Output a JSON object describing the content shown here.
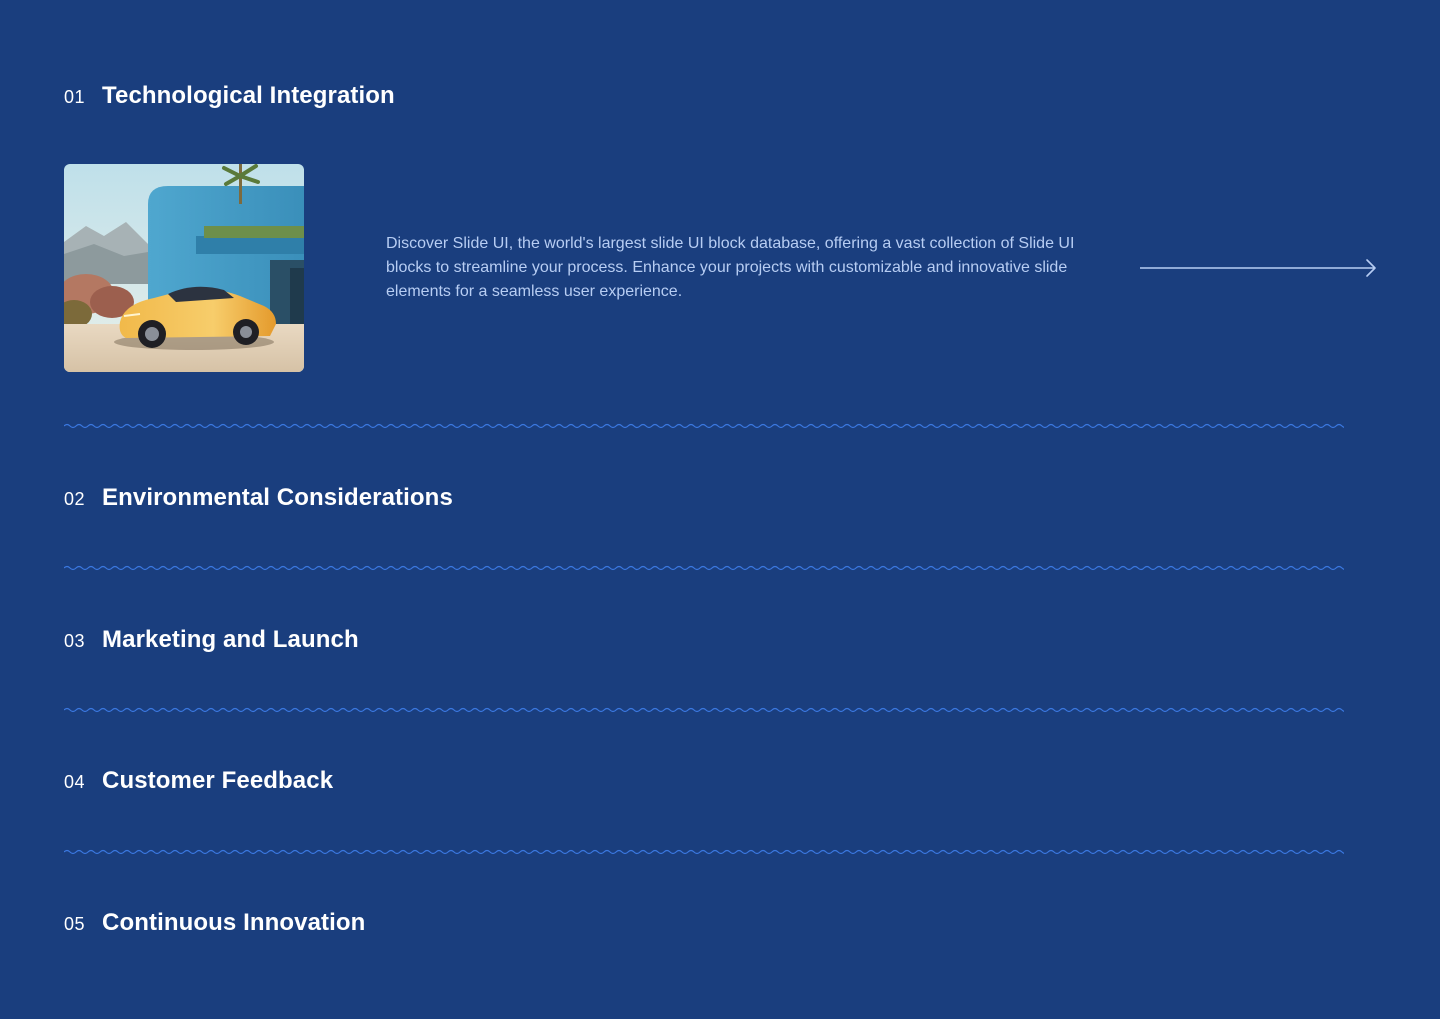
{
  "accordion": {
    "items": [
      {
        "number": "01",
        "title": "Technological Integration"
      },
      {
        "number": "02",
        "title": "Environmental Considerations"
      },
      {
        "number": "03",
        "title": "Marketing and Launch"
      },
      {
        "number": "04",
        "title": "Customer Feedback"
      },
      {
        "number": "05",
        "title": "Continuous Innovation"
      }
    ],
    "expanded": {
      "description": "Discover Slide UI, the world's largest slide UI block database, offering a vast collection of Slide UI blocks to streamline your process. Enhance your projects with customizable and innovative slide elements for a seamless user experience.",
      "arrow_icon": "arrow-right-icon",
      "image_subject": "car-villa-image"
    }
  },
  "colors": {
    "background": "#1a3e7e",
    "divider": "#3b78e0",
    "description_text": "#b7cdf3",
    "title_text": "#ffffff"
  }
}
